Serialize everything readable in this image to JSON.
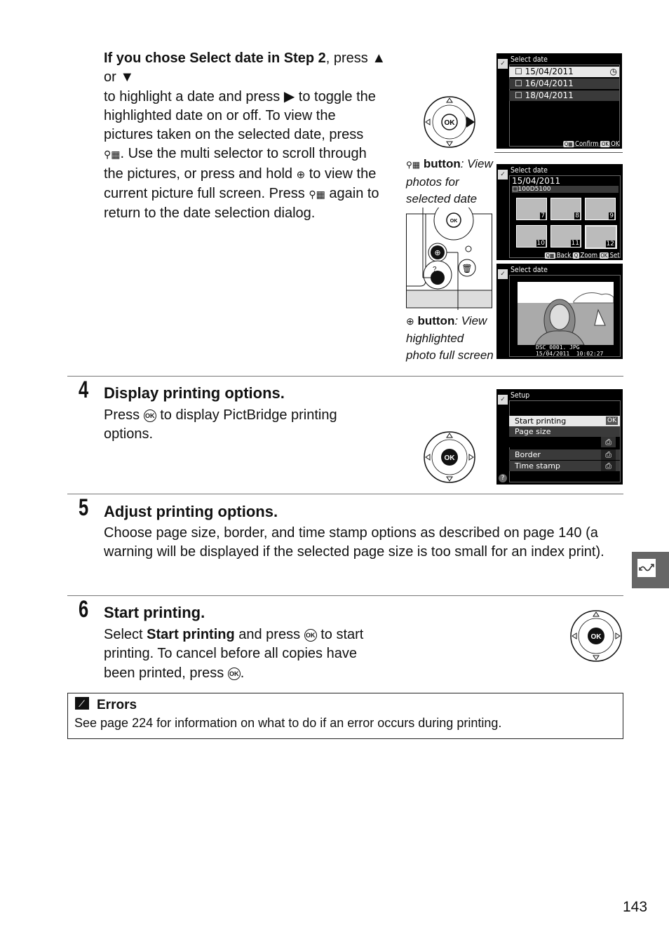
{
  "intro": {
    "lead_bold": "If you chose Select date in Step 2",
    "line1_rest": ", press ▲ or ▼",
    "line2": "to highlight a date and press ▶ to toggle the",
    "line3": "highlighted date on or off.  To view the",
    "line4": "pictures taken on the selected date, press",
    "line5": "ὐD▦.  Use the multi selector to scroll through",
    "line5_text": ".  Use the multi selector to scroll through",
    "line6_a": "the pictures, or press and hold ",
    "line6_b": " to view the",
    "line7_a": "current picture full screen.  Press ",
    "line7_b": " again to",
    "line8": "return to the date selection dialog."
  },
  "callouts": {
    "thumbnail_button": {
      "label": "button",
      "desc": ": View photos for selected date"
    },
    "zoom_button": {
      "label": "button",
      "desc": ": View highlighted photo full screen"
    }
  },
  "screens": {
    "select_date_list": {
      "title": "Select date",
      "dates": [
        "15/04/2011",
        "16/04/2011",
        "18/04/2011"
      ],
      "selected_index": 0,
      "footer_confirm": "Confirm",
      "footer_ok": "OK"
    },
    "select_date_thumbs": {
      "title": "Select date",
      "date": "15/04/2011",
      "folder": "100D5100",
      "thumb_numbers": [
        "7",
        "8",
        "9",
        "10",
        "11",
        "12"
      ],
      "selected_thumb": "12",
      "footer_back": "Back",
      "footer_zoom": "Zoom",
      "footer_set": "Set"
    },
    "select_date_full": {
      "title": "Select date",
      "filename": "DSC_0001. JPG",
      "timestamp": "15/04/2011  10:02:27"
    },
    "setup": {
      "title": "Setup",
      "items": [
        {
          "label": "Start printing",
          "value": "OK"
        },
        {
          "label": "Page size",
          "value": ""
        },
        {
          "label": "",
          "value": "⎙"
        },
        {
          "label": "Border",
          "value": "⎙"
        },
        {
          "label": "Time stamp",
          "value": "⎙"
        }
      ],
      "help": "?"
    }
  },
  "steps": [
    {
      "number": "4",
      "title": "Display printing options.",
      "text_a": "Press ",
      "text_b": " to display PictBridge printing options."
    },
    {
      "number": "5",
      "title": "Adjust printing options.",
      "text": "Choose page size, border, and time stamp options as described on page 140 (a warning will be displayed if the selected page size is too small for an index print)."
    },
    {
      "number": "6",
      "title": "Start printing.",
      "text_a": "Select ",
      "text_bold": "Start printing",
      "text_b": " and press ",
      "text_c": " to start printing.  To cancel before all copies have been printed, press ",
      "text_d": "."
    }
  ],
  "multi_selector": {
    "ok": "OK"
  },
  "note": {
    "title": "Errors",
    "text": "See page 224 for information on what to do if an error occurs during printing."
  },
  "page_number": "143"
}
